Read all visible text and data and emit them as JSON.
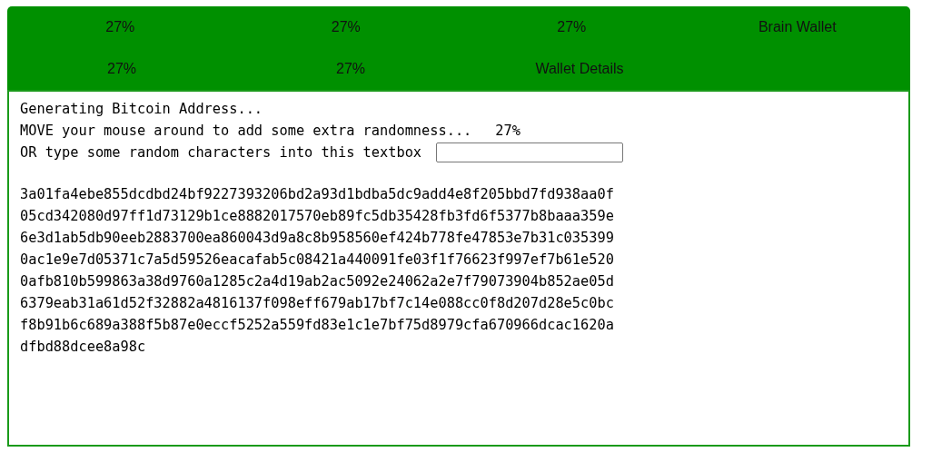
{
  "tabs": [
    [
      {
        "label": "27%",
        "selected": false
      },
      {
        "label": "27%",
        "selected": false
      },
      {
        "label": "27%",
        "selected": false
      },
      {
        "label": "Brain Wallet",
        "selected": false
      }
    ],
    [
      {
        "label": "27%",
        "selected": false
      },
      {
        "label": "27%",
        "selected": false
      },
      {
        "label": "Wallet Details",
        "selected": false
      }
    ]
  ],
  "status": {
    "heading": "Generating Bitcoin Address...",
    "mouse_prompt": "MOVE your mouse around to add some extra randomness...",
    "progress": "27%",
    "type_prompt": "OR type some random characters into this textbox"
  },
  "entropy_lines": [
    "3a01fa4ebe855dcdbd24bf9227393206bd2a93d1bdba5dc9add4e8f205bbd7fd938aa0f",
    "05cd342080d97ff1d73129b1ce8882017570eb89fc5db35428fb3fd6f5377b8baaa359e",
    "6e3d1ab5db90eeb2883700ea860043d9a8c8b958560ef424b778fe47853e7b31c035399",
    "0ac1e9e7d05371c7a5d59526eacafab5c08421a440091fe03f1f76623f997ef7b61e520",
    "0afb810b599863a38d9760a1285c2a4d19ab2ac5092e24062a2e7f79073904b852ae05d",
    "6379eab31a61d52f32882a4816137f098eff679ab17bf7c14e088cc0f8d207d28e5c0bc",
    "f8b91b6c689a388f5b87e0eccf5252a559fd83e1c1e7bf75d8979cfa670966dcac1620a",
    "dfbd88dcee8a98c"
  ]
}
